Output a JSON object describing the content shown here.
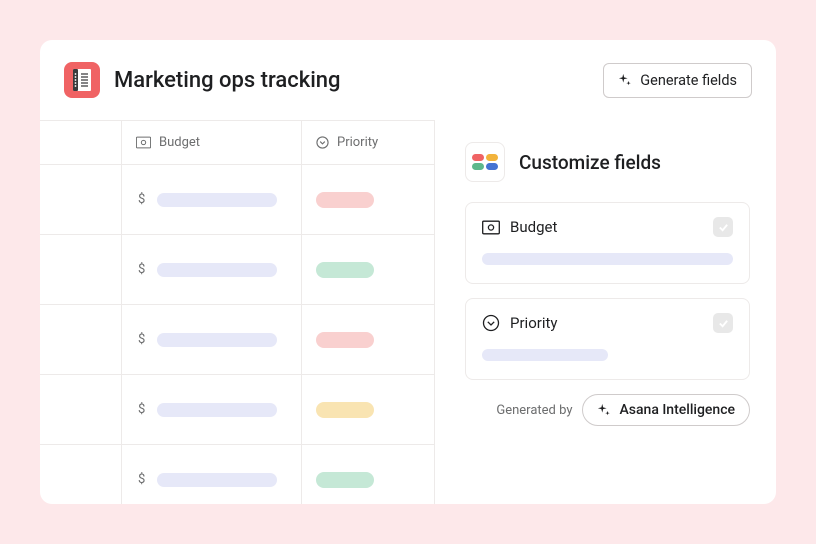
{
  "header": {
    "title": "Marketing ops tracking",
    "generate_label": "Generate fields"
  },
  "table": {
    "columns": {
      "budget": "Budget",
      "priority": "Priority"
    },
    "rows": [
      {
        "currency": "$",
        "priority_color": "red"
      },
      {
        "currency": "$",
        "priority_color": "green"
      },
      {
        "currency": "$",
        "priority_color": "red"
      },
      {
        "currency": "$",
        "priority_color": "yellow"
      },
      {
        "currency": "$",
        "priority_color": "green"
      }
    ]
  },
  "panel": {
    "title": "Customize fields",
    "fields": [
      {
        "label": "Budget",
        "type": "currency",
        "checked": true
      },
      {
        "label": "Priority",
        "type": "select",
        "checked": true
      }
    ],
    "generated_by_label": "Generated by",
    "generated_by_source": "Asana Intelligence"
  },
  "colors": {
    "accent": "#f06364",
    "pill_red": "#f9d0cf",
    "pill_green": "#c5e8d6",
    "pill_yellow": "#f9e4b2",
    "blurb": "#e6e8f8"
  }
}
